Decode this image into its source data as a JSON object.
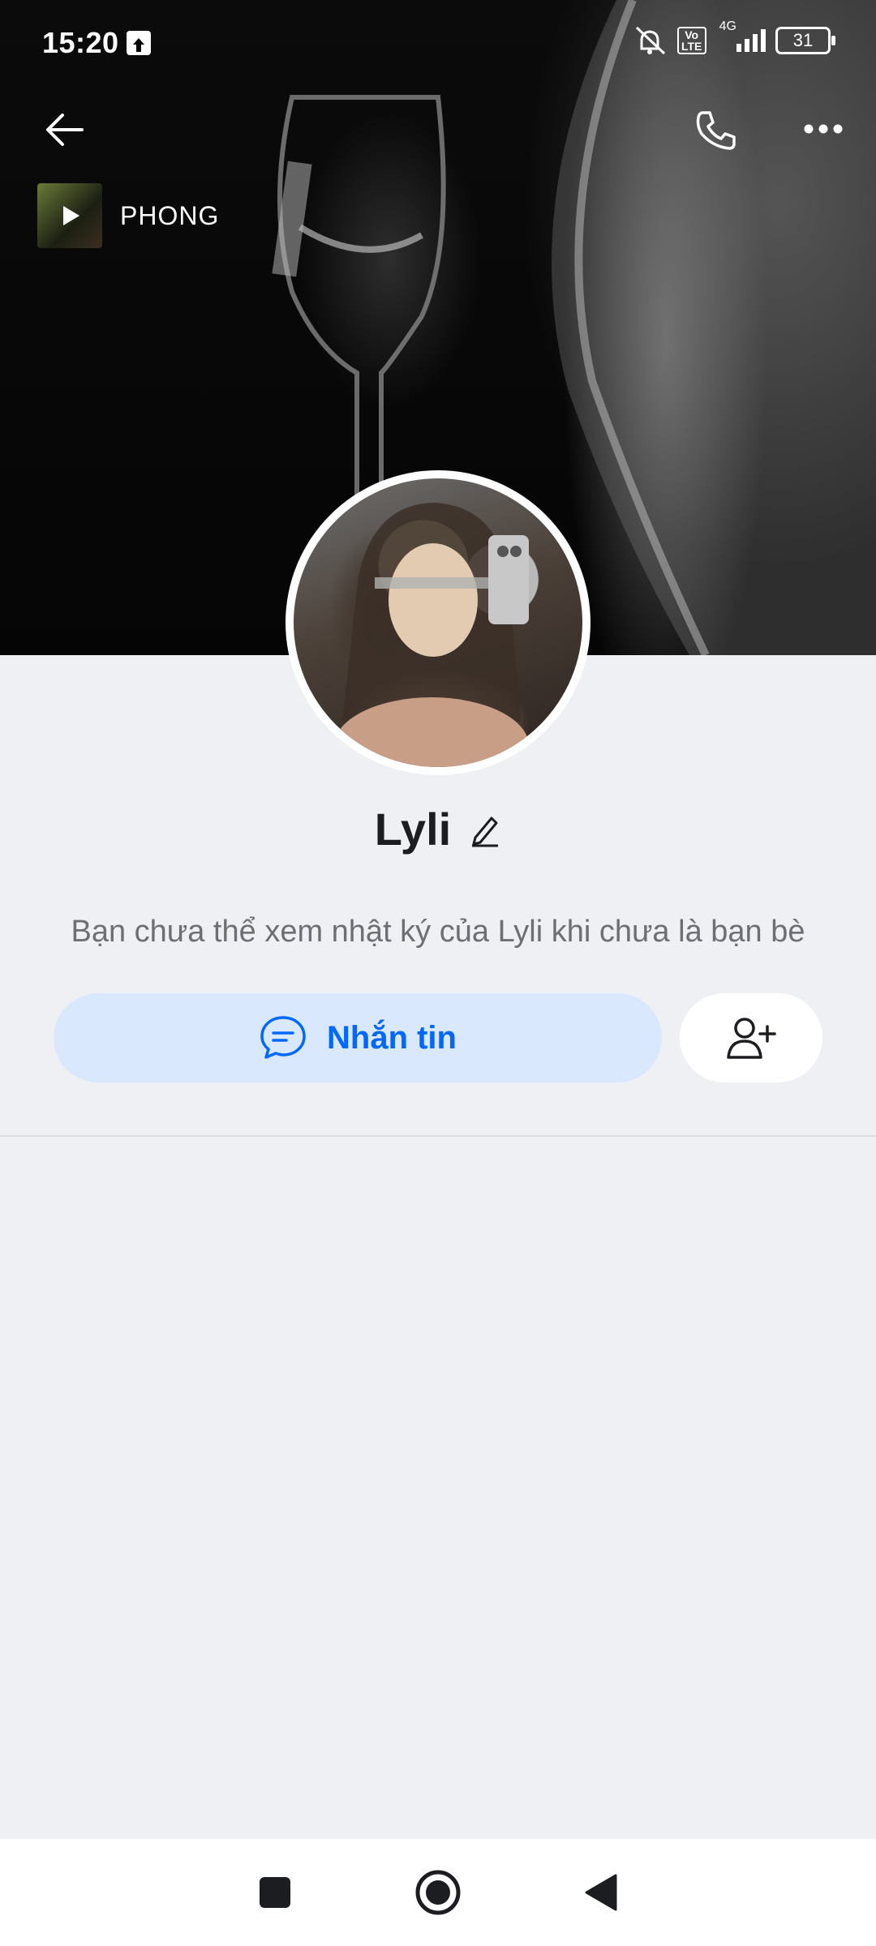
{
  "status_bar": {
    "time": "15:20",
    "network": "4G",
    "volte": "Vo LTE",
    "battery": "31"
  },
  "header": {
    "music_title": "PHONG"
  },
  "profile": {
    "name": "Lyli",
    "privacy_notice": "Bạn chưa thể xem nhật ký của Lyli khi chưa là bạn bè"
  },
  "actions": {
    "message_label": "Nhắn tin"
  },
  "colors": {
    "accent": "#0068ff",
    "message_button_bg": "#d9e8fc",
    "page_bg": "#eff0f4"
  }
}
